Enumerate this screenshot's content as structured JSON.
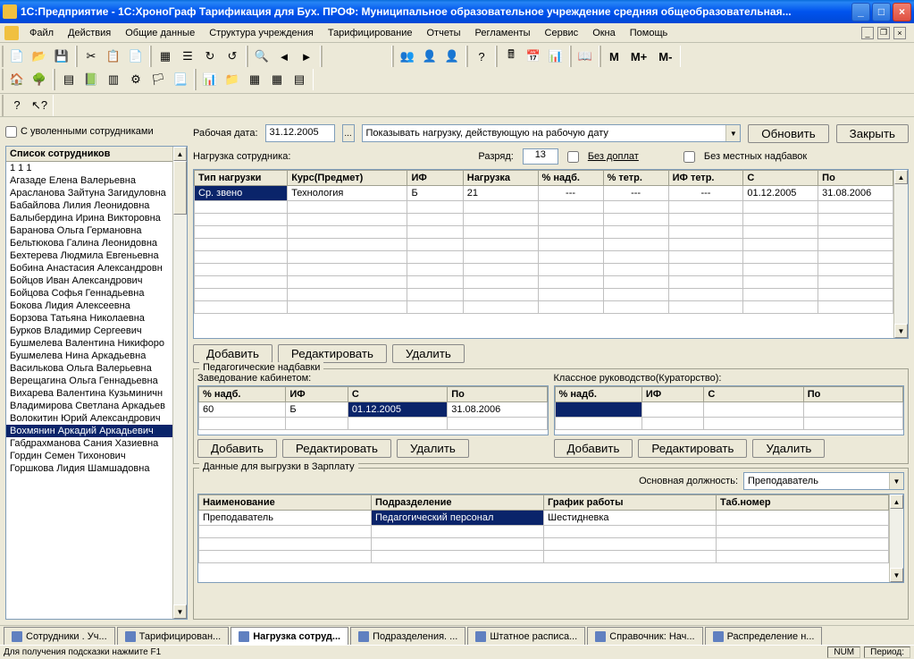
{
  "titlebar": {
    "title": "1С:Предприятие - 1С:ХроноГраф Тарификация для Бух. ПРОФ: Муниципальное образовательное учреждение средняя общеобразовательная..."
  },
  "menu": [
    "Файл",
    "Действия",
    "Общие данные",
    "Структура учреждения",
    "Тарифицирование",
    "Отчеты",
    "Регламенты",
    "Сервис",
    "Окна",
    "Помощь"
  ],
  "left": {
    "checkbox": "С уволенными сотрудниками",
    "header": "Список сотрудников",
    "items": [
      "1 1 1",
      "Агазаде Елена Валерьевна",
      "Арасланова Зайтуна Загидуловна",
      "Бабайлова Лилия Леонидовна",
      "Балыбердина Ирина Викторовна",
      "Баранова Ольга Германовна",
      "Бельтюкова Галина Леонидовна",
      "Бехтерева Людмила Евгеньевна",
      "Бобина Анастасия Александровн",
      "Бойцов Иван Александрович",
      "Бойцова Софья Геннадьевна",
      "Бокова Лидия Алексеевна",
      "Борзова Татьяна Николаевна",
      "Бурков Владимир Сергеевич",
      "Бушмелева Валентина Никифоро",
      "Бушмелева Нина Аркадьевна",
      "Василькова Ольга Валерьевна",
      "Верещагина Ольга Геннадьевна",
      "Вихарева Валентина Кузьминичн",
      "Владимирова Светлана Аркадьев",
      "Волокитин Юрий Александрович",
      "Вохмянин Аркадий Аркадьевич",
      "Габдрахманова Сания Хазиевна",
      "Гордин Семен Тихонович",
      "Горшкова Лидия Шамшадовна"
    ],
    "selected_index": 21
  },
  "toprow": {
    "workdate_label": "Рабочая дата:",
    "workdate": "31.12.2005",
    "combo": "Показывать нагрузку, действующую на рабочую дату",
    "refresh": "Обновить",
    "close": "Закрыть"
  },
  "inforow": {
    "load_label": "Нагрузка сотрудника:",
    "rank_label": "Разряд:",
    "rank": "13",
    "chk1": "Без доплат",
    "chk2": "Без местных надбавок"
  },
  "maingrid": {
    "cols": [
      "Тип нагрузки",
      "Курс(Предмет)",
      "ИФ",
      "Нагрузка",
      "% надб.",
      "% тетр.",
      "ИФ тетр.",
      "С",
      "По"
    ],
    "row": [
      "Ср. звено",
      "Технология",
      "Б",
      "21",
      "---",
      "---",
      "---",
      "01.12.2005",
      "31.08.2006"
    ]
  },
  "btns": {
    "add": "Добавить",
    "edit": "Редактировать",
    "del": "Удалить"
  },
  "ped": {
    "legend": "Педагогические надбавки",
    "sublabel": "Заведование кабинетом:",
    "cols": [
      "% надб.",
      "ИФ",
      "С",
      "По"
    ],
    "row": [
      "60",
      "Б",
      "01.12.2005",
      "31.08.2006"
    ]
  },
  "klass": {
    "label": "Классное руководство(Кураторство):",
    "cols": [
      "% надб.",
      "ИФ",
      "С",
      "По"
    ]
  },
  "export": {
    "legend": "Данные для выгрузки в Зарплату",
    "mainpos_label": "Основная должность:",
    "mainpos": "Преподаватель",
    "cols": [
      "Наименование",
      "Подразделение",
      "График работы",
      "Таб.номер"
    ],
    "row": [
      "Преподаватель",
      "Педагогический персонал",
      "Шестидневка",
      ""
    ]
  },
  "tabs": [
    "Сотрудники . Уч...",
    "Тарифицирован...",
    "Нагрузка сотруд...",
    "Подразделения. ...",
    "Штатное расписа...",
    "Справочник: Нач...",
    "Распределение н..."
  ],
  "status": {
    "hint": "Для получения подсказки нажмите F1",
    "num": "NUM",
    "period": "Период:"
  }
}
